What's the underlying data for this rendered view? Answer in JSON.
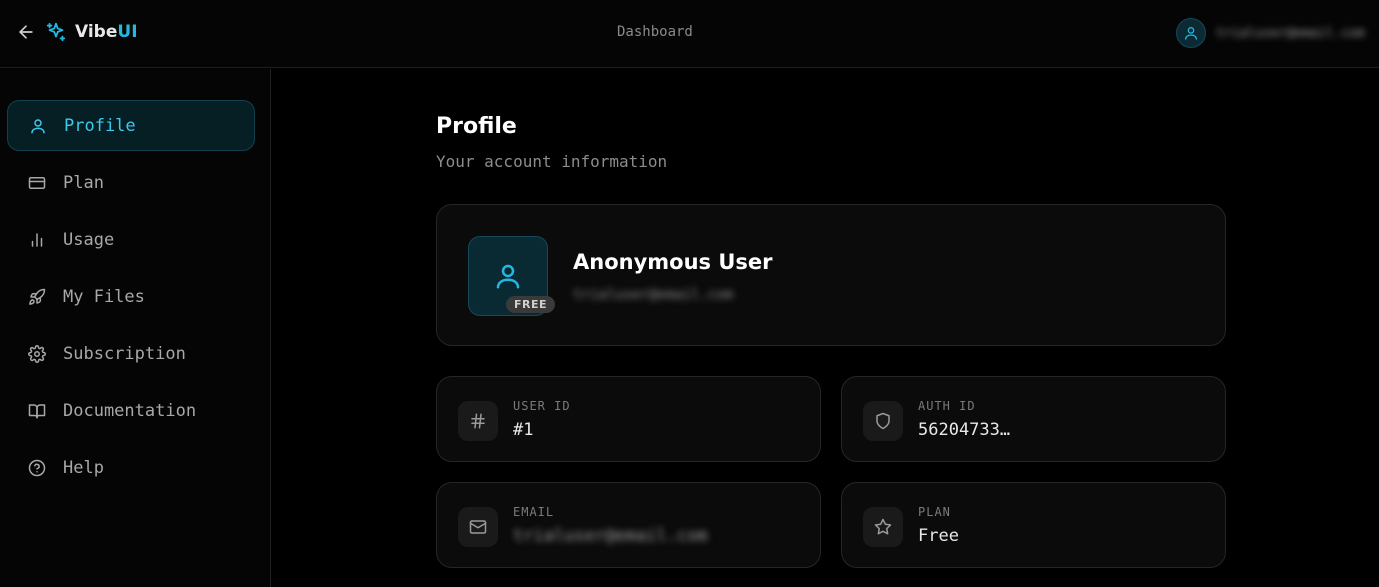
{
  "header": {
    "logo_text_primary": "Vibe",
    "logo_text_accent": "UI",
    "title": "Dashboard",
    "user_email": "trialuser@email.com"
  },
  "sidebar": {
    "items": [
      {
        "label": "Profile",
        "icon": "user-icon",
        "active": true
      },
      {
        "label": "Plan",
        "icon": "credit-card-icon",
        "active": false
      },
      {
        "label": "Usage",
        "icon": "bar-chart-icon",
        "active": false
      },
      {
        "label": "My Files",
        "icon": "rocket-icon",
        "active": false
      },
      {
        "label": "Subscription",
        "icon": "gear-icon",
        "active": false
      },
      {
        "label": "Documentation",
        "icon": "book-icon",
        "active": false
      },
      {
        "label": "Help",
        "icon": "help-circle-icon",
        "active": false
      }
    ]
  },
  "main": {
    "title": "Profile",
    "subtitle": "Your account information",
    "profile": {
      "name": "Anonymous User",
      "email": "trialuser@email.com",
      "tier_badge": "FREE"
    },
    "info": {
      "user_id": {
        "label": "USER ID",
        "value": "#1",
        "icon": "hash-icon"
      },
      "auth_id": {
        "label": "AUTH ID",
        "value": "56204733…",
        "icon": "shield-icon"
      },
      "email": {
        "label": "EMAIL",
        "value": "trialuser@email.com",
        "icon": "mail-icon"
      },
      "plan": {
        "label": "PLAN",
        "value": "Free",
        "icon": "star-icon"
      }
    }
  },
  "colors": {
    "accent": "#22b8e0",
    "background": "#000000",
    "card": "#0b0b0b",
    "border": "#262626"
  }
}
